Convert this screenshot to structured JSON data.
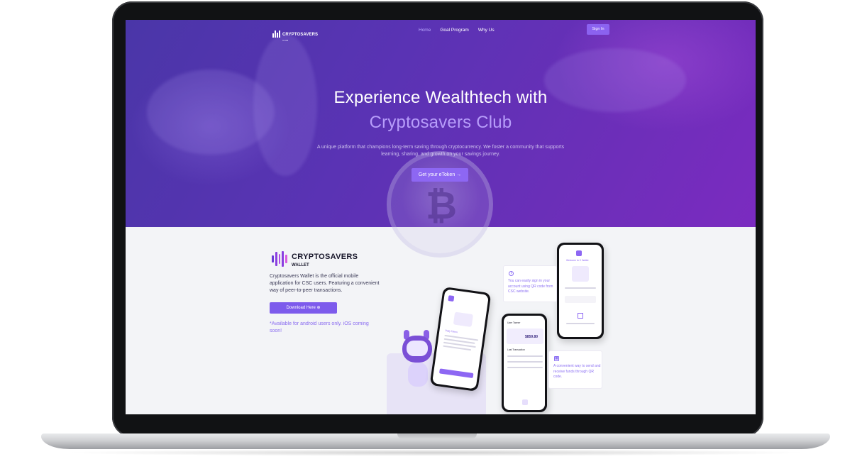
{
  "nav": {
    "brand": "CRYPTOSAVERS",
    "brand_sub": "CLUB",
    "links": [
      "Home",
      "Goal Program",
      "Why Us"
    ],
    "signin": "Sign In"
  },
  "hero": {
    "title_line1": "Experience Wealthtech with",
    "title_line2": "Cryptosavers Club",
    "description": "A unique platform that champions long-term saving through cryptocurrency. We foster a community that supports learning, sharing, and growth on your savings journey.",
    "cta": "Get your eToken →"
  },
  "wallet": {
    "brand": "CRYPTOSAVERS",
    "brand_sub": "WALLET",
    "description": "Cryptosavers Wallet is the official mobile application for CSC users. Featuring a convenient way of peer-to-peer transactions.",
    "download": "Download Here ⊕",
    "availability": "*Available for android users only. iOS coming soon!"
  },
  "features": [
    {
      "text": "You can easily sign in your account using QR code from CSC website.",
      "icon": "info-icon"
    },
    {
      "text": "A convenient way to send and receive funds through QR code.",
      "icon": "qr-icon"
    }
  ],
  "phones": {
    "balance": "$859.80",
    "welcome": "Welcome to C Wallet",
    "transactions": "Last Transaction",
    "daily_token": "Daily Token",
    "user_name": "User Tanner"
  },
  "colors": {
    "accent": "#8d67f3",
    "hero_start": "#4a36a8",
    "hero_end": "#7b2bc0"
  }
}
